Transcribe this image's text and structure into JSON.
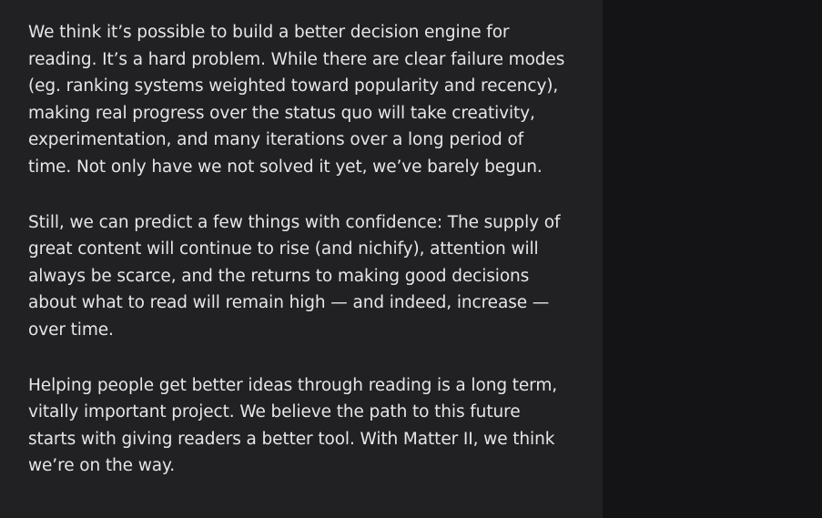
{
  "article": {
    "paragraphs": [
      "We think it’s possible to build a better decision engine for reading. It’s a hard problem. While there are clear failure modes (eg. ranking systems weighted toward popularity and recency), making real progress over the status quo will take creativity, experimentation, and many iterations over a long period of time. Not only have we not solved it yet, we’ve barely begun.",
      "Still, we can predict a few things with confidence: The supply of great content will continue to rise (and nichify), attention will always be scarce, and the returns to making good decisions about what to read will remain high — and indeed, increase — over time.",
      "Helping people get better ideas through reading is a long term, vitally important project. We believe the path to this future starts with giving readers a better tool. With Matter II, we think we’re on the way."
    ]
  },
  "theme": {
    "reader_background": "#212123",
    "side_background": "#141416",
    "text_color": "#e6e6e6"
  }
}
